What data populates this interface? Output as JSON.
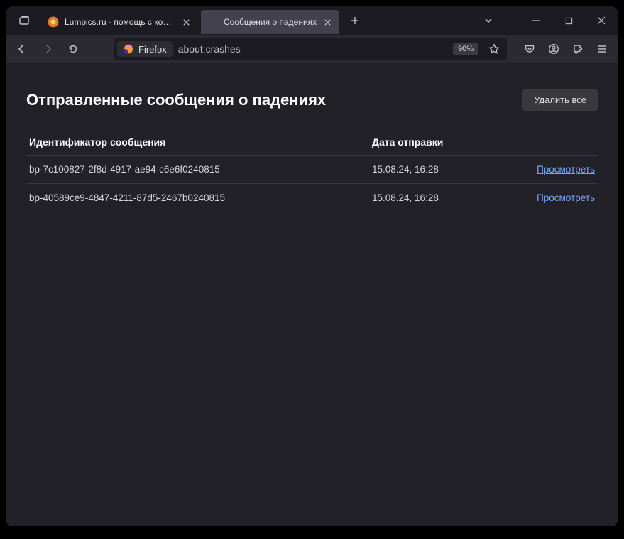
{
  "tabs": [
    {
      "title": "Lumpics.ru - помощь с компь",
      "active": false
    },
    {
      "title": "Сообщения о падениях",
      "active": true
    }
  ],
  "address": {
    "brand": "Firefox",
    "url": "about:crashes",
    "zoom": "90%"
  },
  "page": {
    "title": "Отправленные сообщения о падениях",
    "delete_all": "Удалить все",
    "col_id": "Идентификатор сообщения",
    "col_date": "Дата отправки",
    "action_label": "Просмотреть",
    "rows": [
      {
        "id": "bp-7c100827-2f8d-4917-ae94-c6e6f0240815",
        "date": "15.08.24, 16:28"
      },
      {
        "id": "bp-40589ce9-4847-4211-87d5-2467b0240815",
        "date": "15.08.24, 16:28"
      }
    ]
  }
}
